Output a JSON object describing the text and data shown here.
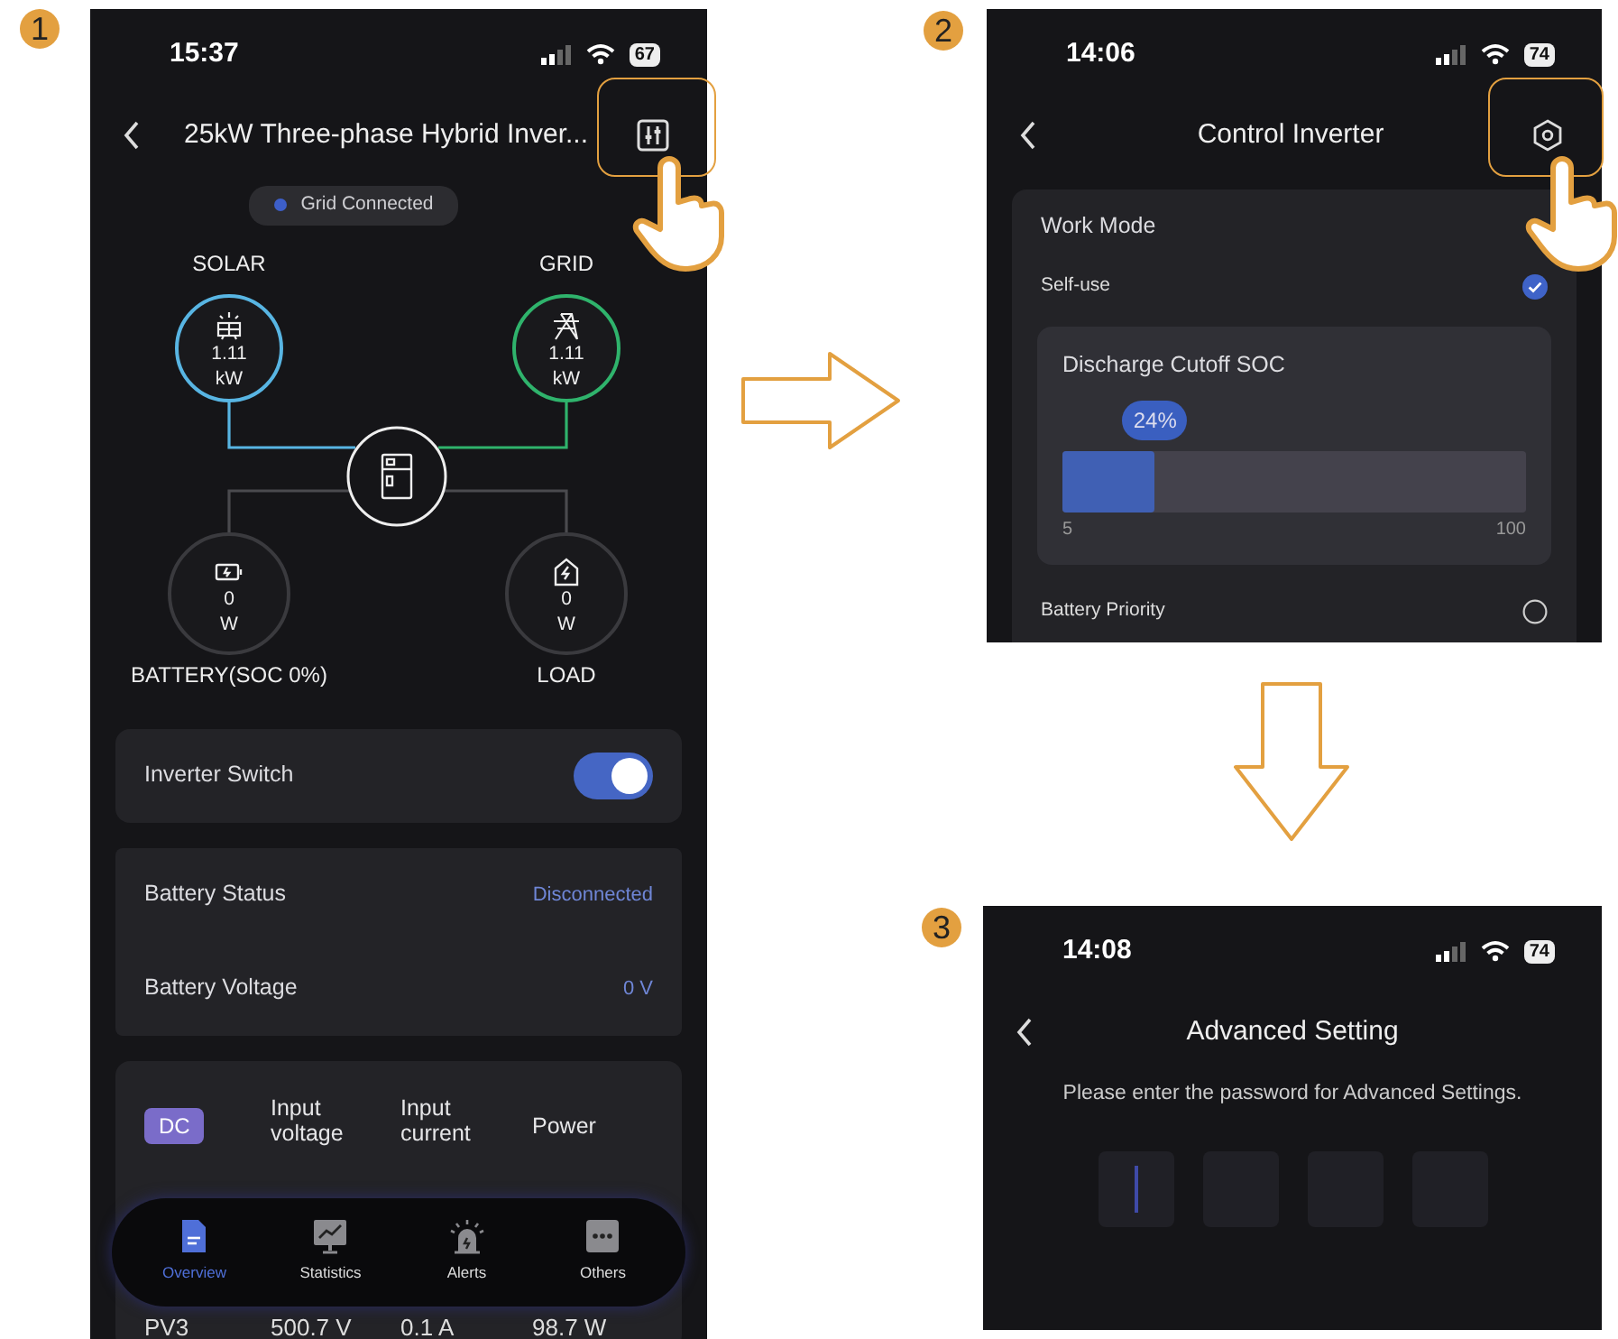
{
  "screens": [
    {
      "kind": "overview",
      "step": "1",
      "status_bar": {
        "time": "15:37",
        "battery": "67"
      },
      "header": {
        "title": "25kW Three-phase Hybrid Inver..."
      },
      "tap_hint": true,
      "status_pill": {
        "label": "Grid Connected",
        "color": "#3d5fc9"
      },
      "flow_nodes": [
        {
          "kind": "solar",
          "label": "SOLAR",
          "value": "1.11",
          "unit": "kW",
          "color": "#58b5e3"
        },
        {
          "kind": "grid",
          "label": "GRID",
          "value": "1.11",
          "unit": "kW",
          "color": "#2fb36c"
        },
        {
          "kind": "battery",
          "label": "BATTERY(SOC 0%)",
          "value": "0",
          "unit": "W",
          "color": "#3a3a3e"
        },
        {
          "kind": "load",
          "label": "LOAD",
          "value": "0",
          "unit": "W",
          "color": "#3a3a3e"
        }
      ],
      "inverter_switch": {
        "label": "Inverter Switch",
        "on": true
      },
      "battery_info": [
        {
          "label": "Battery Status",
          "value": "Disconnected"
        },
        {
          "label": "Battery Voltage",
          "value": "0 V"
        }
      ],
      "dc_table": {
        "columns": [
          "DC",
          "Input voltage",
          "Input current",
          "Power"
        ],
        "rows": [
          [
            "PV3",
            "500.7 V",
            "0.1 A",
            "98.7 W"
          ]
        ]
      },
      "tab_bar": [
        {
          "kind": "overview",
          "label": "Overview",
          "selected": true
        },
        {
          "kind": "statistics",
          "label": "Statistics",
          "selected": false
        },
        {
          "kind": "alerts",
          "label": "Alerts",
          "selected": false
        },
        {
          "kind": "others",
          "label": "Others",
          "selected": false
        }
      ]
    },
    {
      "kind": "control",
      "step": "2",
      "status_bar": {
        "time": "14:06",
        "battery": "74"
      },
      "header": {
        "title": "Control Inverter"
      },
      "tap_hint": true,
      "section": "Work Mode",
      "modes": [
        {
          "label": "Self-use",
          "selected": true,
          "slider": {
            "title": "Discharge Cutoff SOC",
            "value": "24%",
            "level": 0.2,
            "min": "5",
            "max": "100"
          }
        },
        {
          "label": "Battery Priority",
          "selected": false
        }
      ]
    },
    {
      "kind": "password",
      "step": "3",
      "status_bar": {
        "time": "14:08",
        "battery": "74"
      },
      "header": {
        "title": "Advanced Setting"
      },
      "prompt": "Please enter the password for Advanced Settings.",
      "pin_boxes": [
        {
          "focused": true
        },
        {
          "focused": false
        },
        {
          "focused": false
        },
        {
          "focused": false
        }
      ]
    }
  ]
}
